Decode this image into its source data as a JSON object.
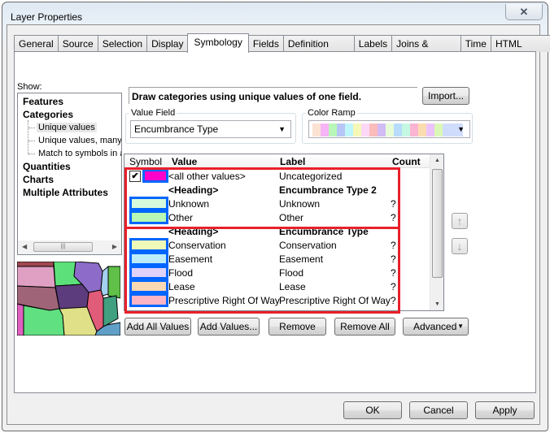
{
  "window": {
    "title": "Layer Properties",
    "close_icon": "close-icon"
  },
  "tabs": [
    {
      "label": "General"
    },
    {
      "label": "Source"
    },
    {
      "label": "Selection"
    },
    {
      "label": "Display"
    },
    {
      "label": "Symbology",
      "active": true
    },
    {
      "label": "Fields"
    },
    {
      "label": "Definition Query"
    },
    {
      "label": "Labels"
    },
    {
      "label": "Joins & Relates"
    },
    {
      "label": "Time"
    },
    {
      "label": "HTML Popup"
    }
  ],
  "show": {
    "label": "Show:",
    "tree": {
      "features": "Features",
      "categories": "Categories",
      "unique_values": "Unique values",
      "unique_values_many": "Unique values, many",
      "match_symbols": "Match to symbols in a",
      "quantities": "Quantities",
      "charts": "Charts",
      "multiple_attributes": "Multiple Attributes"
    },
    "selected": "Unique values"
  },
  "description": "Draw categories using unique values of one field.",
  "import_button": "Import...",
  "value_field": {
    "label": "Value Field",
    "value": "Encumbrance Type"
  },
  "color_ramp": {
    "label": "Color Ramp",
    "colors": [
      "#fbe2d2",
      "#f6b4f6",
      "#b8f7b8",
      "#b8c6f6",
      "#bff6fb",
      "#f6f8b8",
      "#fcd8f6",
      "#fbbcbc",
      "#d2bcf6",
      "#e8fbd8",
      "#b8dcfb",
      "#c4f8e2",
      "#fbb4d2",
      "#fbdcb0",
      "#ecc4fb",
      "#dcf8b8",
      "#d0dcfb"
    ]
  },
  "list": {
    "headers": {
      "symbol": "Symbol",
      "value": "Value",
      "label": "Label",
      "count": "Count"
    },
    "rows": [
      {
        "type": "all",
        "checked": true,
        "color": "#ff00cc",
        "value": "<all other values>",
        "label": "Uncategorized",
        "count": ""
      },
      {
        "type": "heading",
        "value": "<Heading>",
        "label": "Encumbrance Type 2",
        "count": ""
      },
      {
        "type": "item",
        "color": "#d8fadc",
        "value": "Unknown",
        "label": "Unknown",
        "count": "?"
      },
      {
        "type": "item",
        "color": "#b8f8b4",
        "value": "Other",
        "label": "Other",
        "count": "?"
      },
      {
        "type": "heading",
        "value": "<Heading>",
        "label": "Encumbrance Type",
        "count": ""
      },
      {
        "type": "item",
        "color": "#f0fab8",
        "value": "Conservation",
        "label": "Conservation",
        "count": "?"
      },
      {
        "type": "item",
        "color": "#bcecfa",
        "value": "Easement",
        "label": "Easement",
        "count": "?"
      },
      {
        "type": "item",
        "color": "#e0d2fa",
        "value": "Flood",
        "label": "Flood",
        "count": "?"
      },
      {
        "type": "item",
        "color": "#fad8b4",
        "value": "Lease",
        "label": "Lease",
        "count": "?"
      },
      {
        "type": "item",
        "color": "#fab4c4",
        "value": "Prescriptive Right Of Way",
        "label": "Prescriptive Right Of Way",
        "count": "?"
      }
    ]
  },
  "actions": {
    "add_all": "Add All Values",
    "add_values": "Add Values...",
    "remove": "Remove",
    "remove_all": "Remove All",
    "advanced": "Advanced"
  },
  "footer": {
    "ok": "OK",
    "cancel": "Cancel",
    "apply": "Apply"
  },
  "highlight_color": "#e8202a",
  "symbol_border_color": "#0066ff"
}
